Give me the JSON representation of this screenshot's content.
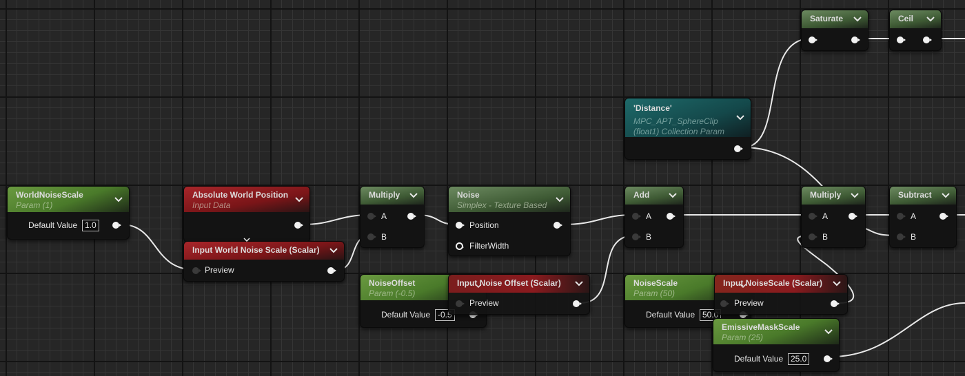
{
  "canvas": {
    "type": "material-graph-editor"
  },
  "nodes": {
    "world_noise_scale": {
      "title": "WorldNoiseScale",
      "subtitle": "Param (1)",
      "row_label": "Default Value",
      "value": "1.0"
    },
    "absolute_world_position": {
      "title": "Absolute World Position",
      "subtitle": "Input Data"
    },
    "input_world_noise_scale": {
      "title": "Input World Noise Scale (Scalar)",
      "pin_preview": "Preview"
    },
    "multiply_1": {
      "title": "Multiply",
      "pin_a": "A",
      "pin_b": "B"
    },
    "noise": {
      "title": "Noise",
      "subtitle": "Simplex - Texture Based",
      "pin_position": "Position",
      "pin_filterwidth": "FilterWidth"
    },
    "noise_offset": {
      "title": "NoiseOffset",
      "subtitle": "Param (-0.5)",
      "row_label": "Default Value",
      "value": "-0.5"
    },
    "input_noise_offset": {
      "title": "Input Noise Offset (Scalar)",
      "pin_preview": "Preview"
    },
    "distance": {
      "title": "'Distance'",
      "subtitle_line1": "MPC_APT_SphereClip",
      "subtitle_line2": "(float1) Collection Param"
    },
    "add": {
      "title": "Add",
      "pin_a": "A",
      "pin_b": "B"
    },
    "noise_scale": {
      "title": "NoiseScale",
      "subtitle": "Param (50)",
      "row_label": "Default Value",
      "value": "50.0"
    },
    "input_noise_scale": {
      "title": "Input NoiseScale (Scalar)",
      "pin_preview": "Preview"
    },
    "emissive_mask_scale": {
      "title": "EmissiveMaskScale",
      "subtitle": "Param (25)",
      "row_label": "Default Value",
      "value": "25.0"
    },
    "saturate": {
      "title": "Saturate"
    },
    "ceil": {
      "title": "Ceil"
    },
    "multiply_2": {
      "title": "Multiply",
      "pin_a": "A",
      "pin_b": "B"
    },
    "subtract": {
      "title": "Subtract",
      "pin_a": "A",
      "pin_b": "B"
    }
  },
  "icons": {
    "collapse": "chevron-down-icon",
    "pin": "exec-pin-icon"
  }
}
